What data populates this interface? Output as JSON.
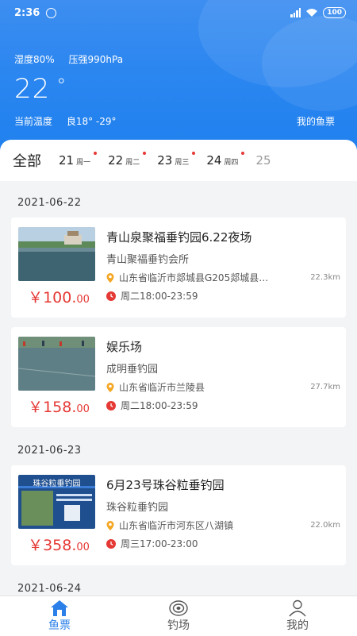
{
  "status_bar": {
    "time": "2:36",
    "battery": "100"
  },
  "weather": {
    "humidity": "湿度80%",
    "pressure": "压强990hPa",
    "temperature": "22",
    "degree_symbol": "°",
    "temp_label": "当前温度",
    "quality_range": "良18° -29°",
    "my_tickets": "我的鱼票"
  },
  "tabs": {
    "all": "全部",
    "days": [
      {
        "day": "21",
        "weekday": "周一"
      },
      {
        "day": "22",
        "weekday": "周二"
      },
      {
        "day": "23",
        "weekday": "周三"
      },
      {
        "day": "24",
        "weekday": "周四"
      },
      {
        "day": "25",
        "weekday": ""
      }
    ]
  },
  "groups": [
    {
      "date": "2021-06-22",
      "cards": [
        {
          "title": "青山泉聚福垂钓园6.22夜场",
          "venue": "青山聚福垂钓会所",
          "address": "山东省临沂市郯城县G205郯城县…",
          "distance": "22.3km",
          "time": "周二18:00-23:59",
          "price_main": "￥100.",
          "price_cents": "00"
        },
        {
          "title": "娱乐场",
          "venue": "成明垂钓园",
          "address": "山东省临沂市兰陵县",
          "distance": "27.7km",
          "time": "周二18:00-23:59",
          "price_main": "￥158.",
          "price_cents": "00"
        }
      ]
    },
    {
      "date": "2021-06-23",
      "cards": [
        {
          "title": "6月23号珠谷粒垂钓园",
          "venue": "珠谷粒垂钓园",
          "address": "山东省临沂市河东区八湖镇",
          "distance": "22.0km",
          "time": "周三17:00-23:00",
          "price_main": "￥358.",
          "price_cents": "00",
          "thumb_text": "珠谷粒垂钓园"
        }
      ]
    },
    {
      "date": "2021-06-24"
    }
  ],
  "nav": {
    "tickets": "鱼票",
    "spots": "钓场",
    "mine": "我的"
  },
  "colors": {
    "primary": "#2a7fe8",
    "price": "#e53935",
    "header": "#2b86f0"
  }
}
